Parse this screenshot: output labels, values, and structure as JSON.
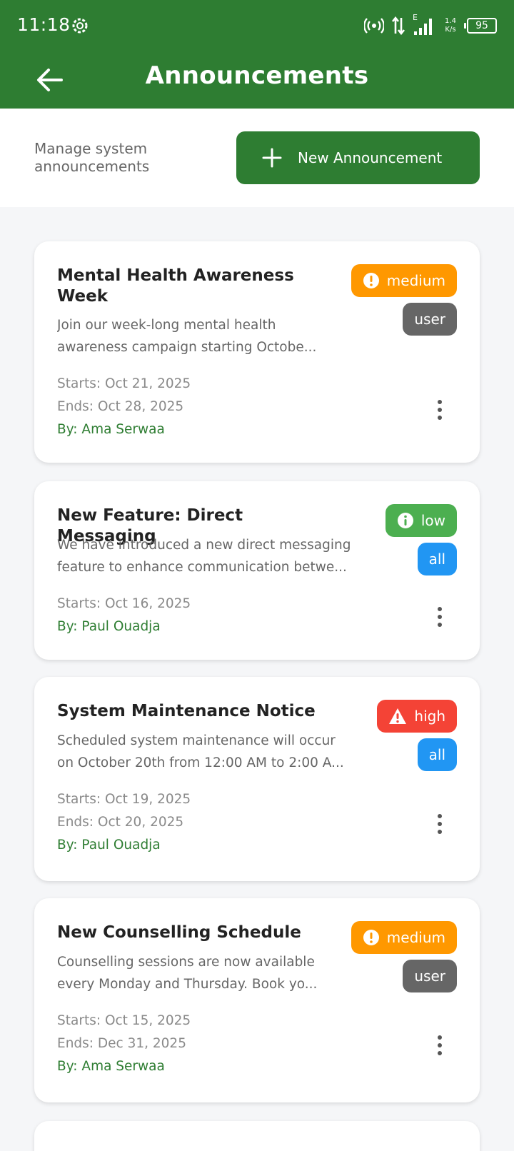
{
  "status_bar": {
    "time": "11:18",
    "net_speed_value": "1.4",
    "net_speed_unit": "K/s",
    "battery": "95",
    "net_type": "E"
  },
  "app_bar": {
    "title": "Announcements",
    "back_icon": "arrow-left-icon"
  },
  "toolbar": {
    "subtitle": "Manage system announcements",
    "new_button_label": "New Announcement",
    "new_button_icon": "plus-icon"
  },
  "colors": {
    "brand_green": "#2e7d32",
    "medium": "#ff9800",
    "low": "#4caf50",
    "high": "#f44336",
    "user": "#666666",
    "all": "#2196f3"
  },
  "announcements": [
    {
      "title": "Mental Health Awareness Week",
      "description": "Join our week-long mental health awareness campaign starting Octobe...",
      "desc_line1": "Join our week-long mental health",
      "desc_line2": "awareness campaign starting Octobe...",
      "priority": "medium",
      "audience": "user",
      "starts": "Starts: Oct 21, 2025",
      "ends": "Ends: Oct 28, 2025",
      "author": "By: Ama Serwaa"
    },
    {
      "title": "New Feature: Direct Messaging",
      "desc_line1": "We have introduced a new direct messaging",
      "desc_line2": "feature to enhance communication betwe...",
      "priority": "low",
      "audience": "all",
      "starts": "Starts: Oct 16, 2025",
      "author": "By: Paul Ouadja"
    },
    {
      "title": "System Maintenance Notice",
      "desc_line1": "Scheduled system maintenance will occur",
      "desc_line2": "on October 20th from 12:00 AM to 2:00 A...",
      "priority": "high",
      "audience": "all",
      "starts": "Starts: Oct 19, 2025",
      "ends": "Ends: Oct 20, 2025",
      "author": "By: Paul Ouadja"
    },
    {
      "title": "New Counselling Schedule",
      "desc_line1": "Counselling sessions are now available",
      "desc_line2": "every Monday and Thursday. Book yo...",
      "priority": "medium",
      "audience": "user",
      "starts": "Starts: Oct 15, 2025",
      "ends": "Ends: Dec 31, 2025",
      "author": "By: Ama Serwaa"
    }
  ]
}
